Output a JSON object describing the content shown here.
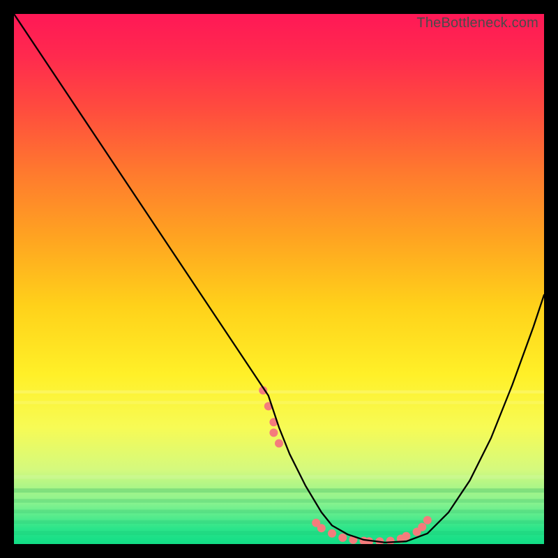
{
  "watermark": "TheBottleneck.com",
  "chart_data": {
    "type": "line",
    "title": "",
    "xlabel": "",
    "ylabel": "",
    "xlim": [
      0,
      100
    ],
    "ylim": [
      0,
      100
    ],
    "x": [
      0,
      5,
      10,
      15,
      20,
      25,
      30,
      35,
      40,
      45,
      48,
      50,
      52,
      55,
      58,
      60,
      63,
      66,
      70,
      74,
      78,
      82,
      86,
      90,
      94,
      98,
      100
    ],
    "values": [
      100,
      92.5,
      85,
      77.5,
      70,
      62.5,
      55,
      47.5,
      40,
      32.5,
      28,
      22,
      17,
      11,
      6,
      3.5,
      1.8,
      0.8,
      0.3,
      0.5,
      2,
      6,
      12,
      20,
      30,
      41,
      47
    ],
    "zone_boundary_pct": 72,
    "scatter": {
      "x": [
        47,
        48,
        49,
        49,
        50,
        57,
        58,
        60,
        62,
        64,
        66,
        67,
        69,
        71,
        73,
        74,
        76,
        77,
        78
      ],
      "y": [
        29,
        26,
        23,
        21,
        19,
        4,
        3,
        2,
        1.2,
        0.8,
        0.6,
        0.5,
        0.5,
        0.6,
        1.0,
        1.5,
        2.3,
        3.2,
        4.5
      ],
      "color": "#f47c7c",
      "radius": 6
    },
    "gradient_stops": [
      {
        "offset": 0.0,
        "color": "#ff1856"
      },
      {
        "offset": 0.08,
        "color": "#ff2a4e"
      },
      {
        "offset": 0.18,
        "color": "#ff4c3e"
      },
      {
        "offset": 0.3,
        "color": "#ff7a2e"
      },
      {
        "offset": 0.42,
        "color": "#ffa321"
      },
      {
        "offset": 0.55,
        "color": "#ffd11a"
      },
      {
        "offset": 0.68,
        "color": "#fff028"
      },
      {
        "offset": 0.78,
        "color": "#f7fb55"
      },
      {
        "offset": 0.86,
        "color": "#d4f97e"
      },
      {
        "offset": 0.92,
        "color": "#8bf38f"
      },
      {
        "offset": 0.97,
        "color": "#2de58a"
      },
      {
        "offset": 1.0,
        "color": "#11dd86"
      }
    ],
    "band_stripes": [
      {
        "y_pct": 71.0,
        "h_pct": 0.6,
        "color": "rgba(255,255,255,0.18)"
      },
      {
        "y_pct": 73.0,
        "h_pct": 0.6,
        "color": "rgba(255,255,255,0.12)"
      },
      {
        "y_pct": 87.0,
        "h_pct": 0.7,
        "color": "rgba(255,255,255,0.10)"
      },
      {
        "y_pct": 89.5,
        "h_pct": 0.8,
        "color": "rgba(0,150,80,0.22)"
      },
      {
        "y_pct": 91.5,
        "h_pct": 0.7,
        "color": "rgba(0,150,80,0.18)"
      },
      {
        "y_pct": 93.5,
        "h_pct": 0.7,
        "color": "rgba(0,150,80,0.14)"
      },
      {
        "y_pct": 95.5,
        "h_pct": 0.7,
        "color": "rgba(0,150,80,0.12)"
      },
      {
        "y_pct": 97.5,
        "h_pct": 0.8,
        "color": "rgba(0,150,80,0.10)"
      }
    ]
  }
}
